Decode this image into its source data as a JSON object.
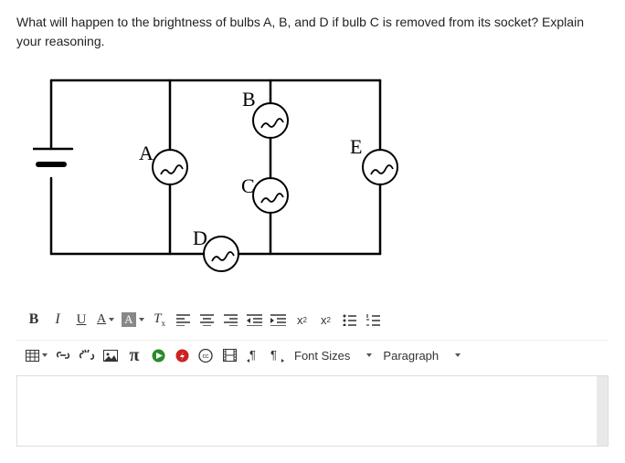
{
  "question": "What will happen to the brightness of bulbs A, B, and D if bulb C is removed from its socket?  Explain your reasoning.",
  "diagram": {
    "bulbs": {
      "A": "A",
      "B": "B",
      "C": "C",
      "D": "D",
      "E": "E"
    }
  },
  "toolbar": {
    "bold": "B",
    "italic": "I",
    "underline": "U",
    "textcolor": "A",
    "highlight": "A",
    "clearformat_T": "T",
    "clearformat_x": "x",
    "pi": "π",
    "cc": "cc",
    "sup_base": "x",
    "sup_exp": "2",
    "sub_base": "x",
    "sub_exp": "2",
    "fontsize_label": "Font Sizes",
    "paragraph_label": "Paragraph"
  }
}
